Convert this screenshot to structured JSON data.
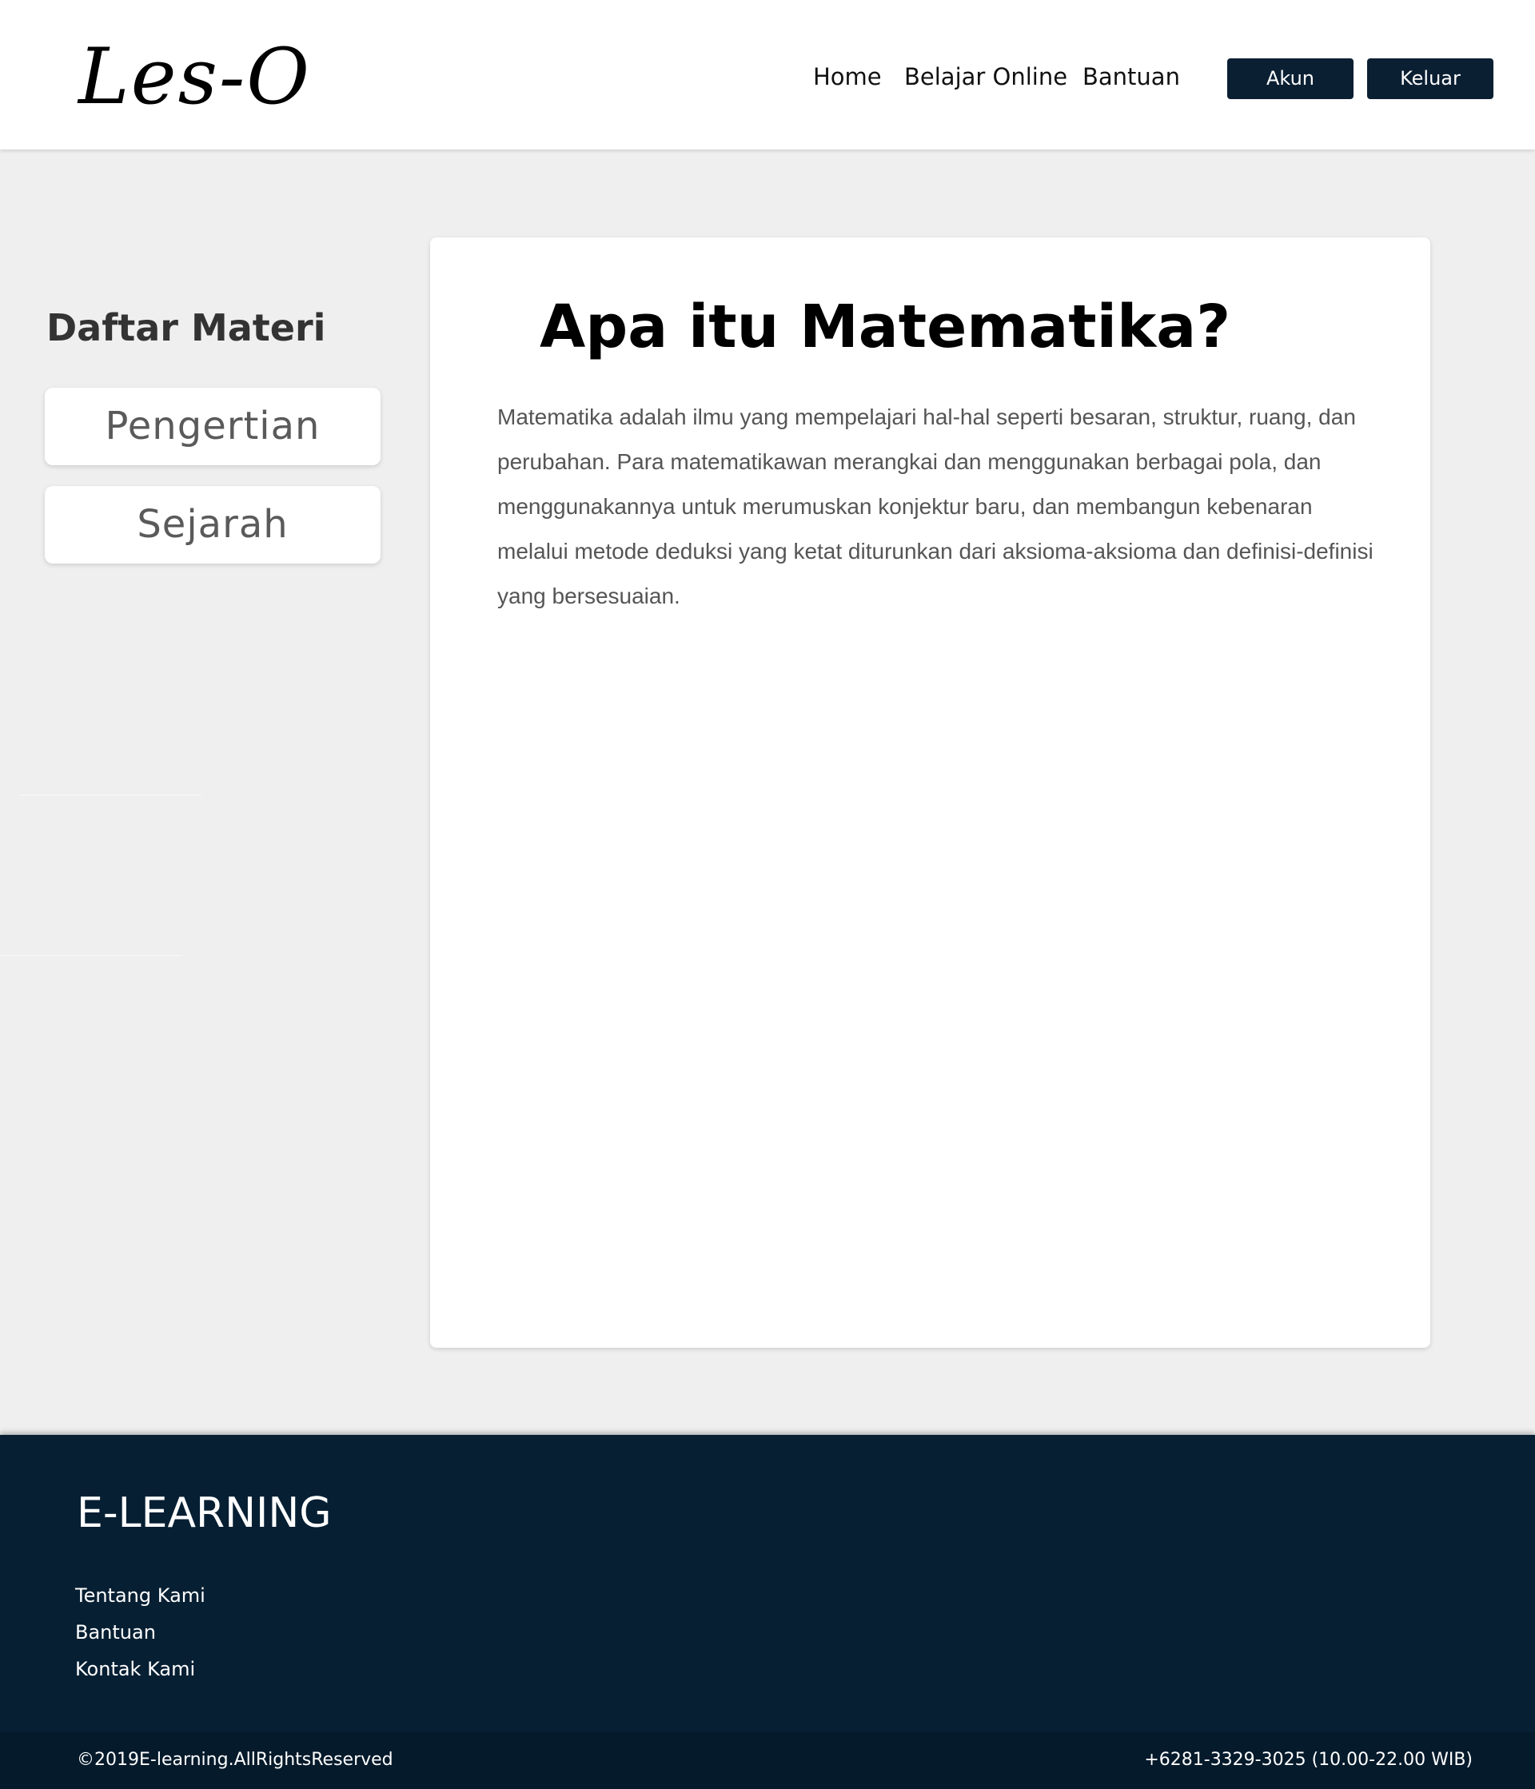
{
  "header": {
    "logo": "Les-O",
    "nav": {
      "home": "Home",
      "belajar_online": "Belajar Online",
      "bantuan": "Bantuan"
    },
    "buttons": {
      "akun": "Akun",
      "keluar": "Keluar"
    }
  },
  "sidebar": {
    "title": "Daftar Materi",
    "items": [
      {
        "label": "Pengertian"
      },
      {
        "label": "Sejarah"
      }
    ]
  },
  "content": {
    "title": "Apa itu Matematika?",
    "body": "Matematika adalah ilmu yang mempelajari hal-hal seperti besaran, struktur, ruang, dan perubahan. Para matematikawan merangkai dan menggunakan berbagai pola, dan menggunakannya untuk merumuskan konjektur baru, dan membangun kebenaran melalui metode deduksi yang ketat diturunkan dari aksioma-aksioma dan definisi-definisi yang bersesuaian."
  },
  "footer": {
    "title": "E-LEARNING",
    "links": {
      "tentang_kami": "Tentang Kami",
      "bantuan": "Bantuan",
      "kontak_kami": "Kontak Kami"
    },
    "copyright": "©2019E-learning.AllRightsReserved",
    "contact": "+6281-3329-3025 (10.00-22.00 WIB)"
  },
  "colors": {
    "navy": "#061f33",
    "button": "#0b1f33",
    "page_background": "#efefef",
    "card": "#ffffff"
  }
}
